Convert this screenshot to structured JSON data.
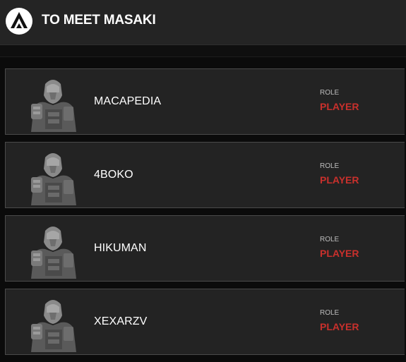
{
  "header": {
    "title": "TO MEET MASAKI",
    "logo_icon": "apex-legends-logo-icon"
  },
  "colors": {
    "role_value": "#c9302c",
    "card_bg": "#232323",
    "header_bg": "#242424"
  },
  "members": [
    {
      "name": "MACAPEDIA",
      "role_label": "ROLE",
      "role": "PLAYER",
      "avatar_icon": "player-portrait-icon"
    },
    {
      "name": "4BOKO",
      "role_label": "ROLE",
      "role": "PLAYER",
      "avatar_icon": "player-portrait-icon"
    },
    {
      "name": "HIKUMAN",
      "role_label": "ROLE",
      "role": "PLAYER",
      "avatar_icon": "player-portrait-icon"
    },
    {
      "name": "XEXARZV",
      "role_label": "ROLE",
      "role": "PLAYER",
      "avatar_icon": "player-portrait-icon"
    }
  ]
}
